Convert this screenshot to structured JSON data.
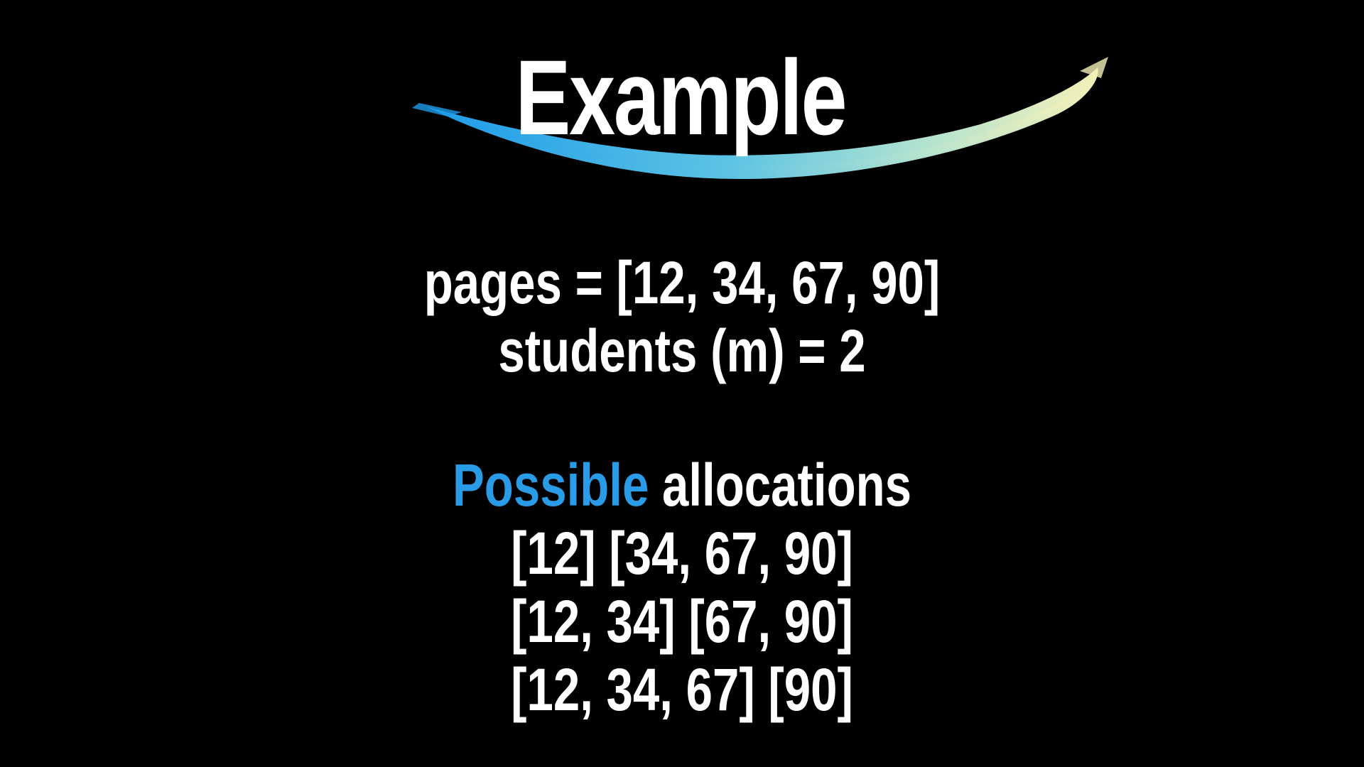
{
  "slide": {
    "title": "Example",
    "brush_colors": {
      "start": "#1e9be8",
      "middle": "#8fd8d8",
      "end": "#f4f0b8"
    },
    "params": [
      "pages = [12, 34, 67, 90]",
      "students (m) = 2"
    ],
    "allocations": {
      "heading_accent": "Possible",
      "heading_rest": " allocations",
      "accent_color": "#2a9be6",
      "rows": [
        "[12] [34, 67, 90]",
        "[12, 34] [67, 90]",
        "[12, 34, 67] [90]"
      ]
    }
  }
}
